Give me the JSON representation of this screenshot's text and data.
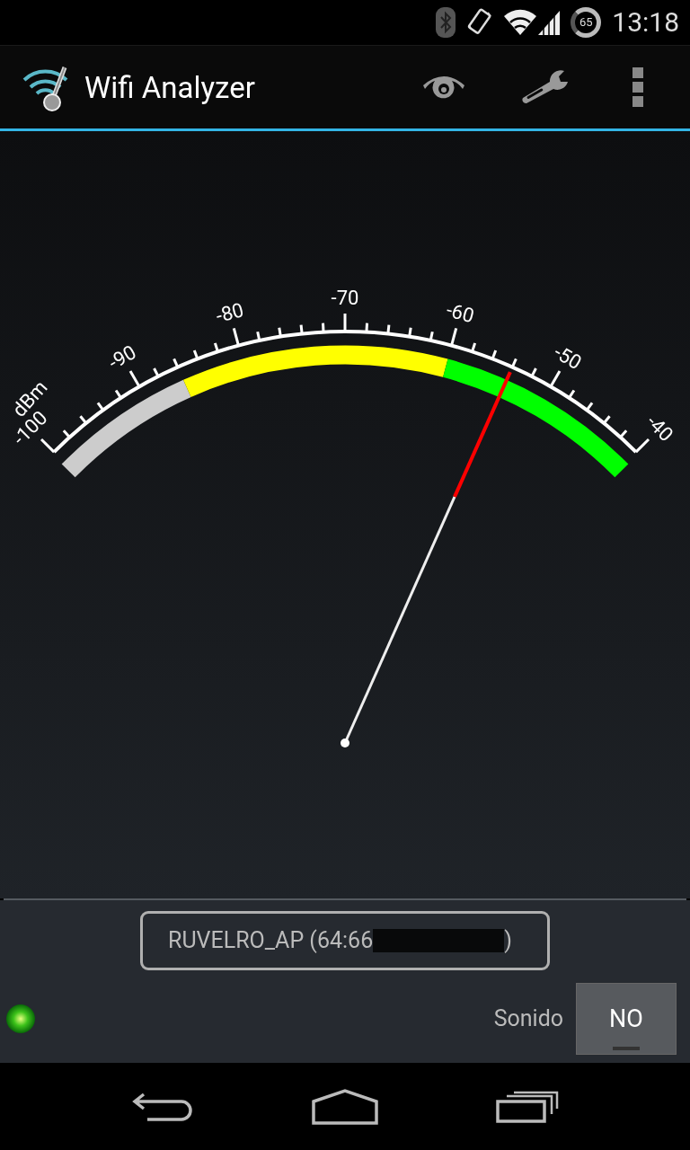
{
  "status_bar": {
    "battery": "65",
    "time": "13:18"
  },
  "action_bar": {
    "title": "Wifi Analyzer"
  },
  "gauge": {
    "unit": "dBm",
    "labels": [
      "-100",
      "-90",
      "-80",
      "-70",
      "-60",
      "-50",
      "-40"
    ]
  },
  "network": {
    "name": "RUVELRO_AP (64:66",
    "suffix": ")"
  },
  "signal_led": {
    "on": true
  },
  "sound": {
    "label": "Sonido",
    "button": "NO",
    "on": false
  }
}
